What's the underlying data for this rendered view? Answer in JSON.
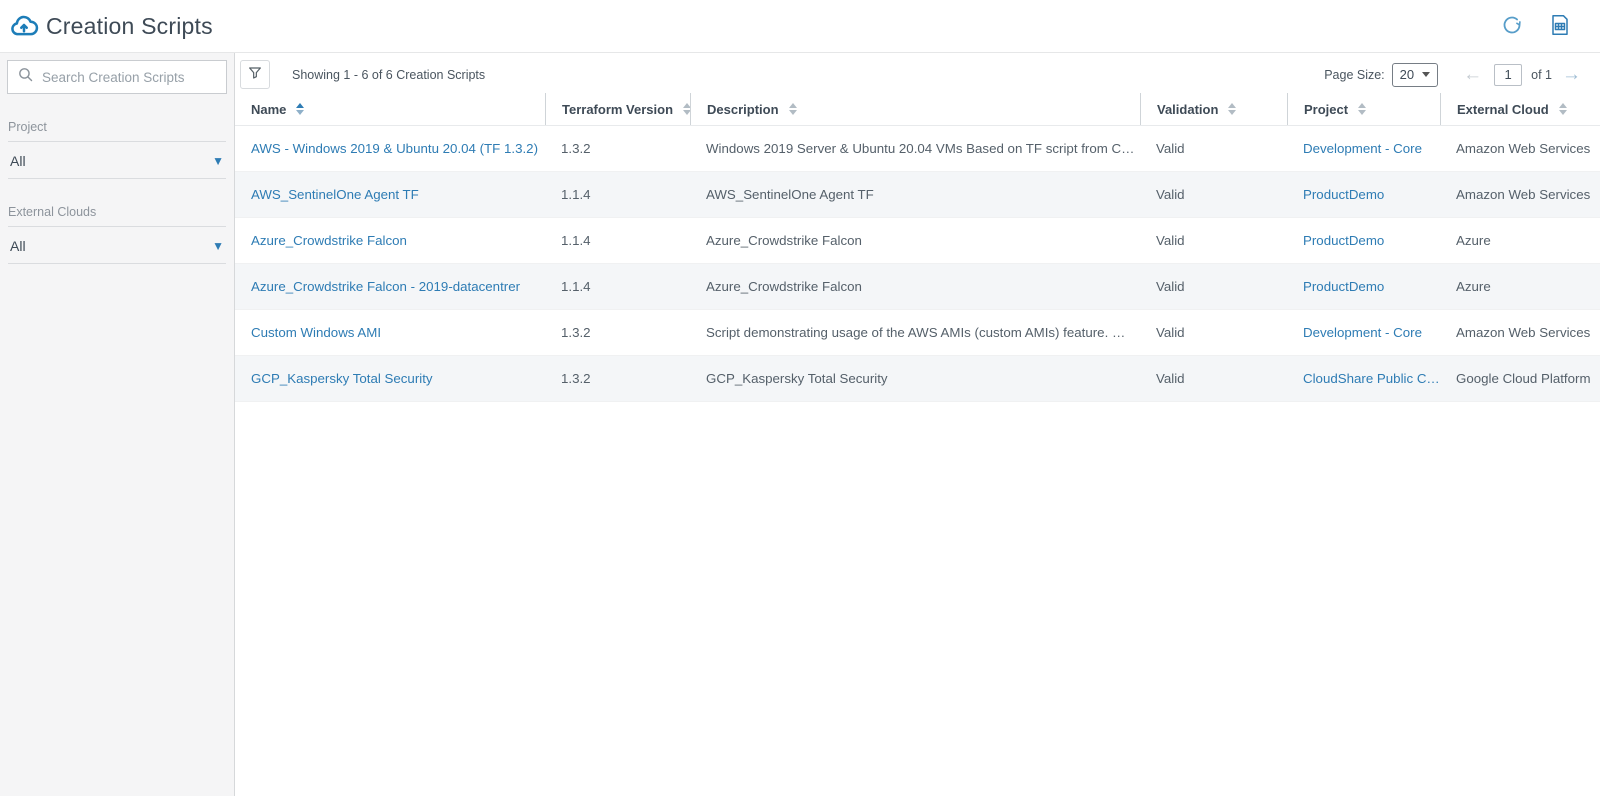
{
  "header": {
    "title": "Creation Scripts"
  },
  "sidebar": {
    "search_placeholder": "Search Creation Scripts",
    "filters": [
      {
        "label": "Project",
        "value": "All"
      },
      {
        "label": "External Clouds",
        "value": "All"
      }
    ]
  },
  "toolbar": {
    "showing_text": "Showing 1 - 6 of 6 Creation Scripts",
    "page_size_label": "Page Size:",
    "page_size_value": "20",
    "page_current": "1",
    "page_of_label": "of 1"
  },
  "table": {
    "columns": [
      {
        "label": "Name",
        "sort": "asc"
      },
      {
        "label": "Terraform Version",
        "sort": "none"
      },
      {
        "label": "Description",
        "sort": "none"
      },
      {
        "label": "Validation",
        "sort": "none"
      },
      {
        "label": "Project",
        "sort": "none"
      },
      {
        "label": "External Cloud",
        "sort": "none"
      }
    ],
    "rows": [
      {
        "name": "AWS - Windows 2019 & Ubuntu 20.04 (TF 1.3.2)",
        "terraform_version": "1.3.2",
        "description": "Windows 2019 Server & Ubuntu 20.04 VMs Based on TF script from C…",
        "validation": "Valid",
        "project": "Development - Core",
        "external_cloud": "Amazon Web Services"
      },
      {
        "name": "AWS_SentinelOne Agent TF",
        "terraform_version": "1.1.4",
        "description": "AWS_SentinelOne Agent TF",
        "validation": "Valid",
        "project": "ProductDemo",
        "external_cloud": "Amazon Web Services"
      },
      {
        "name": "Azure_Crowdstrike Falcon",
        "terraform_version": "1.1.4",
        "description": "Azure_Crowdstrike Falcon",
        "validation": "Valid",
        "project": "ProductDemo",
        "external_cloud": "Azure"
      },
      {
        "name": "Azure_Crowdstrike Falcon - 2019-datacentrer",
        "terraform_version": "1.1.4",
        "description": "Azure_Crowdstrike Falcon",
        "validation": "Valid",
        "project": "ProductDemo",
        "external_cloud": "Azure"
      },
      {
        "name": "Custom Windows AMI",
        "terraform_version": "1.3.2",
        "description": "Script demonstrating usage of the AWS AMIs (custom AMIs) feature. …",
        "validation": "Valid",
        "project": "Development - Core",
        "external_cloud": "Amazon Web Services"
      },
      {
        "name": "GCP_Kaspersky Total Security",
        "terraform_version": "1.3.2",
        "description": "GCP_Kaspersky Total Security",
        "validation": "Valid",
        "project": "CloudShare Public C…",
        "external_cloud": "Google Cloud Platform"
      }
    ]
  },
  "colors": {
    "link": "#2e7cb4",
    "accent": "#1d7db8",
    "zebra": "#f4f6f8",
    "dark": "#3e4a56",
    "sidebar-bg": "#f5f5f6"
  }
}
